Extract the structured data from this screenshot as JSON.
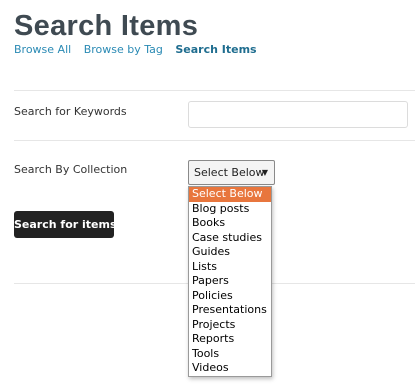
{
  "page": {
    "title": "Search Items"
  },
  "nav": {
    "items": [
      {
        "label": "Browse All",
        "active": false
      },
      {
        "label": "Browse by Tag",
        "active": false
      },
      {
        "label": "Search Items",
        "active": true
      }
    ]
  },
  "form": {
    "keywords_label": "Search for Keywords",
    "keywords_value": "",
    "keywords_placeholder": "",
    "collection_label": "Search By Collection",
    "collection_selected": "Select Below",
    "collection_options": [
      "Select Below",
      "Blog posts",
      "Books",
      "Case studies",
      "Guides",
      "Lists",
      "Papers",
      "Policies",
      "Presentations",
      "Projects",
      "Reports",
      "Tools",
      "Videos"
    ],
    "submit_label": "Search for items"
  },
  "colors": {
    "title": "#3f4a52",
    "link": "#2a8ab4",
    "button_bg": "#222222",
    "option_highlight": "#e8763d"
  }
}
